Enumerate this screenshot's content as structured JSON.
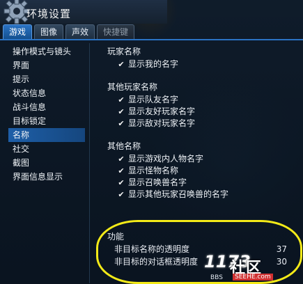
{
  "window": {
    "title": "环境设置"
  },
  "tabs": [
    {
      "label": "游戏",
      "state": "active"
    },
    {
      "label": "图像",
      "state": "normal"
    },
    {
      "label": "声效",
      "state": "normal"
    },
    {
      "label": "快捷键",
      "state": "disabled"
    }
  ],
  "nav": {
    "items": [
      "操作模式与镜头",
      "界面",
      "提示",
      "状态信息",
      "战斗信息",
      "目标锁定",
      "名称",
      "社交",
      "截图",
      "界面信息显示"
    ],
    "selected_index": 6
  },
  "sections": [
    {
      "title": "玩家名称",
      "options": [
        {
          "label": "显示我的名字",
          "checked": true
        }
      ]
    },
    {
      "title": "其他玩家名称",
      "options": [
        {
          "label": "显示队友名字",
          "checked": true
        },
        {
          "label": "显示友好玩家名字",
          "checked": true
        },
        {
          "label": "显示敌对玩家名字",
          "checked": true
        }
      ]
    },
    {
      "title": "其他名称",
      "options": [
        {
          "label": "显示游戏内人物名字",
          "checked": true
        },
        {
          "label": "显示怪物名称",
          "checked": true
        },
        {
          "label": "显示召唤兽名字",
          "checked": true
        },
        {
          "label": "显示其他玩家召唤兽的名字",
          "checked": true
        }
      ]
    }
  ],
  "function": {
    "title": "功能",
    "sliders": [
      {
        "label": "非目标名称的透明度",
        "value": "37"
      },
      {
        "label": "非目标的对话框透明度",
        "value": "30"
      }
    ]
  },
  "watermark": {
    "num": "1173",
    "text": "社区",
    "url": "SEEHE.com",
    "bbs": "BBS"
  },
  "colors": {
    "accent": "#2a73c4",
    "highlight": "#f3ea18"
  }
}
